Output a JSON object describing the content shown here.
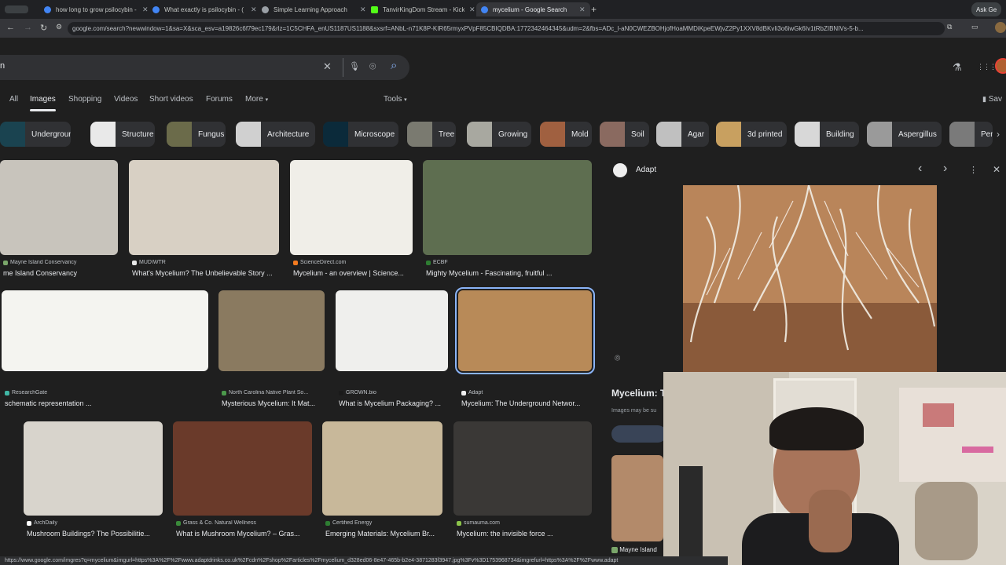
{
  "tabs": [
    {
      "title": "how long to grow psilocybin -",
      "color": "#4285f4"
    },
    {
      "title": "What exactly is psilocybin - (",
      "color": "#4285f4"
    },
    {
      "title": "Simple Learning Approach",
      "color": "#9aa0a6"
    },
    {
      "title": "TanvirKingDom Stream - Kick",
      "color": "#53fc18"
    },
    {
      "title": "mycelium - Google Search",
      "color": "#4285f4"
    }
  ],
  "tab_close": "✕",
  "new_tab": "+",
  "ask_gemini": "Ask Ge",
  "url": "google.com/search?newwindow=1&sa=X&sca_esv=a19826c6f79ec179&rlz=1C5CHFA_enUS1187US1188&sxsrf=ANbL-n71K8P-KIR65rmyxPVpF85CBIQDBA:1772342464345&udm=2&fbs=ADc_l-aN0CWEZBOHjofHoaMMDiKpeEWjvZ2Py1XXV8dBKvIi3o6iwGk6Iv1tRbZIBNIVs-5-b...",
  "search_query": "n",
  "filters": {
    "all": "All",
    "images": "Images",
    "shopping": "Shopping",
    "videos": "Videos",
    "short_videos": "Short videos",
    "forums": "Forums",
    "more": "More",
    "tools": "Tools",
    "saved": "Sav"
  },
  "chips": [
    {
      "label": "Underground",
      "color": "#1a4350"
    },
    {
      "label": "Structure",
      "color": "#e9e9e9"
    },
    {
      "label": "Fungus",
      "color": "#6b6b4a"
    },
    {
      "label": "Architecture",
      "color": "#d0d0d0"
    },
    {
      "label": "Microscope",
      "color": "#0b2a3a"
    },
    {
      "label": "Tree",
      "color": "#7a7a70"
    },
    {
      "label": "Growing",
      "color": "#a8a8a0"
    },
    {
      "label": "Mold",
      "color": "#a06040"
    },
    {
      "label": "Soil",
      "color": "#8a6a60"
    },
    {
      "label": "Agar",
      "color": "#c0c0c0"
    },
    {
      "label": "3d printed",
      "color": "#c8a060"
    },
    {
      "label": "Building",
      "color": "#d8d8d8"
    },
    {
      "label": "Aspergillus",
      "color": "#9a9a9a"
    },
    {
      "label": "Pen",
      "color": "#7a7a7a"
    }
  ],
  "results": {
    "r1": [
      {
        "source": "Mayne Island Conservancy",
        "title": "me Island Conservancy",
        "color": "#c8c4bc",
        "fav": "#7aa66a"
      },
      {
        "source": "MUD\\WTR",
        "title": "What's Mycelium? The Unbelievable Story ...",
        "color": "#d8d0c4",
        "fav": "#e8e8e8"
      },
      {
        "source": "ScienceDirect.com",
        "title": "Mycelium - an overview | Science...",
        "color": "#f0eee8",
        "fav": "#f47b20"
      },
      {
        "source": "ECBF",
        "title": "Mighty Mycelium - Fascinating, fruitful ...",
        "color": "#5e6e50",
        "fav": "#2e7d32"
      }
    ],
    "r2": [
      {
        "source": "ResearchGate",
        "title": "schematic representation ...",
        "color": "#f4f4f0",
        "fav": "#40b7a5"
      },
      {
        "source": "North Carolina Native Plant So...",
        "title": "Mysterious Mycelium: It Mat...",
        "color": "#8a7a60",
        "fav": "#4c9a4c"
      },
      {
        "source": "GROWN.bio",
        "title": "What is Mycelium Packaging? ...",
        "color": "#efefed",
        "fav": "#1a1a1a"
      },
      {
        "source": "Adapt",
        "title": "Mycelium: The Underground Networ...",
        "color": "#b88a58",
        "fav": "#eeeeee"
      }
    ],
    "r3": [
      {
        "source": "ArchDaily",
        "title": "Mushroom Buildings? The Possibilitie...",
        "color": "#d8d4cc",
        "fav": "#ffffff"
      },
      {
        "source": "Grass & Co. Natural Wellness",
        "title": "What is Mushroom Mycelium? – Gras...",
        "color": "#6a3a2a",
        "fav": "#3a8a3a"
      },
      {
        "source": "Certified Energy",
        "title": "Emerging Materials: Mycelium Br...",
        "color": "#c8b89a",
        "fav": "#2e7d32"
      },
      {
        "source": "sumauma.com",
        "title": "Mycelium: the invisible force ...",
        "color": "#3a3836",
        "fav": "#8bc34a"
      }
    ]
  },
  "panel": {
    "source": "Adapt",
    "title": "Mycelium: T",
    "subtitle": "Images may be su",
    "bottom_source": "Mayne Island",
    "image_color": "#b9855a"
  },
  "status_url": "https://www.google.com/imgres?q=mycelium&imgurl=https%3A%2F%2Fwww.adaptdrinks.co.uk%2Fcdn%2Fshop%2Farticles%2Fmycelium_d328ed06-8e47-465b-b2e4-3871283f3947.jpg%3Fv%3D1753968734&imgrefurl=https%3A%2F%2Fwww.adapt",
  "icons": {
    "back": "←",
    "forward": "→",
    "reload": "↻",
    "bookmark": "☆",
    "clear": "✕",
    "mic": "🎤",
    "lens": "⌾",
    "search": "⌕",
    "labs": "⚗",
    "apps": "⋮⋮⋮",
    "prev": "‹",
    "next": "›",
    "more": "⋮",
    "close": "✕"
  }
}
